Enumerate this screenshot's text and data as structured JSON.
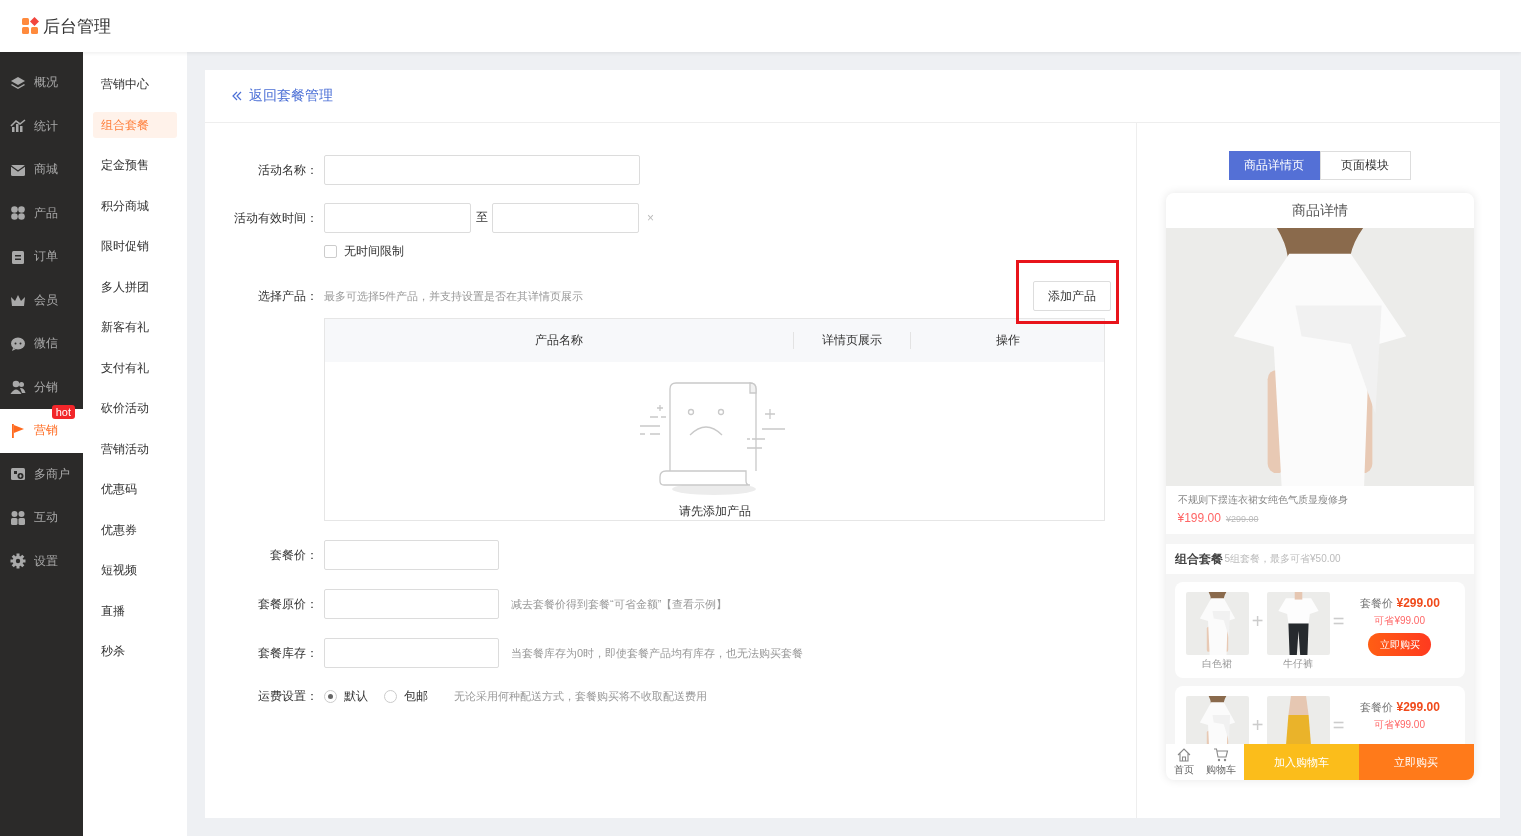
{
  "header": {
    "title": "后台管理"
  },
  "main_nav": [
    {
      "label": "概况",
      "selected": false
    },
    {
      "label": "统计",
      "selected": false
    },
    {
      "label": "商城",
      "selected": false
    },
    {
      "label": "产品",
      "selected": false
    },
    {
      "label": "订单",
      "selected": false
    },
    {
      "label": "会员",
      "selected": false
    },
    {
      "label": "微信",
      "selected": false
    },
    {
      "label": "分销",
      "selected": false
    },
    {
      "label": "营销",
      "selected": true,
      "badge": "hot"
    },
    {
      "label": "多商户",
      "selected": false
    },
    {
      "label": "互动",
      "selected": false
    },
    {
      "label": "设置",
      "selected": false
    }
  ],
  "sub_nav": [
    {
      "label": "营销中心",
      "selected": false
    },
    {
      "label": "组合套餐",
      "selected": true
    },
    {
      "label": "定金预售",
      "selected": false
    },
    {
      "label": "积分商城",
      "selected": false
    },
    {
      "label": "限时促销",
      "selected": false
    },
    {
      "label": "多人拼团",
      "selected": false
    },
    {
      "label": "新客有礼",
      "selected": false
    },
    {
      "label": "支付有礼",
      "selected": false
    },
    {
      "label": "砍价活动",
      "selected": false
    },
    {
      "label": "营销活动",
      "selected": false
    },
    {
      "label": "优惠码",
      "selected": false
    },
    {
      "label": "优惠券",
      "selected": false
    },
    {
      "label": "短视频",
      "selected": false
    },
    {
      "label": "直播",
      "selected": false
    },
    {
      "label": "秒杀",
      "selected": false
    }
  ],
  "back_link": {
    "label": "返回套餐管理"
  },
  "form": [
    {
      "kind": "text_wide",
      "label": "活动名称："
    },
    {
      "kind": "daterange",
      "label": "活动有效时间：",
      "separator": "至",
      "clear": "×",
      "checkbox": {
        "label": "无时间限制",
        "checked": false
      }
    },
    {
      "kind": "products",
      "label": "选择产品：",
      "hint": "最多可选择5件产品，并支持设置是否在其详情页展示",
      "button": "添加产品",
      "highlighted": true,
      "columns": [
        "产品名称",
        "详情页展示",
        "操作"
      ],
      "empty_text": "请先添加产品"
    },
    {
      "kind": "text",
      "label": "套餐价："
    },
    {
      "kind": "text",
      "label": "套餐原价：",
      "hint": "减去套餐价得到套餐“可省金额”【查看示例】"
    },
    {
      "kind": "text",
      "label": "套餐库存：",
      "hint": "当套餐库存为0时，即使套餐产品均有库存，也无法购买套餐"
    },
    {
      "kind": "radio",
      "label": "运费设置：",
      "options": [
        {
          "label": "默认",
          "selected": true
        },
        {
          "label": "包邮",
          "selected": false
        }
      ],
      "hint": "无论采用何种配送方式，套餐购买将不收取配送费用"
    }
  ],
  "preview": {
    "tabs": [
      {
        "label": "商品详情页",
        "selected": true
      },
      {
        "label": "页面模块",
        "selected": false
      }
    ],
    "phone_title": "商品详情",
    "product": {
      "name": "不规则下摆连衣裙女纯色气质显瘦修身",
      "price": "¥199.00",
      "original_price": "¥299.00"
    },
    "bundles_section": {
      "title": "组合套餐",
      "subtitle": "5组套餐，最多可省¥50.00"
    },
    "bundles": [
      {
        "items": [
          {
            "kind": "picture",
            "name": "白色裙"
          },
          {
            "kind": "picture",
            "name": "牛仔裤"
          }
        ],
        "plus": "+",
        "equals": "=",
        "price_label": "套餐价",
        "price": "¥299.00",
        "saving": "可省¥99.00",
        "button": "立即购买"
      },
      {
        "plus": "+",
        "equals": "=",
        "price_label": "套餐价",
        "price": "¥299.00",
        "saving": "可省¥99.00"
      }
    ],
    "bottom_bar": {
      "icons": [
        {
          "label": "首页"
        },
        {
          "label": "购物车"
        }
      ],
      "add_to_cart": "加入购物车",
      "buy_now": "立即购买"
    }
  }
}
